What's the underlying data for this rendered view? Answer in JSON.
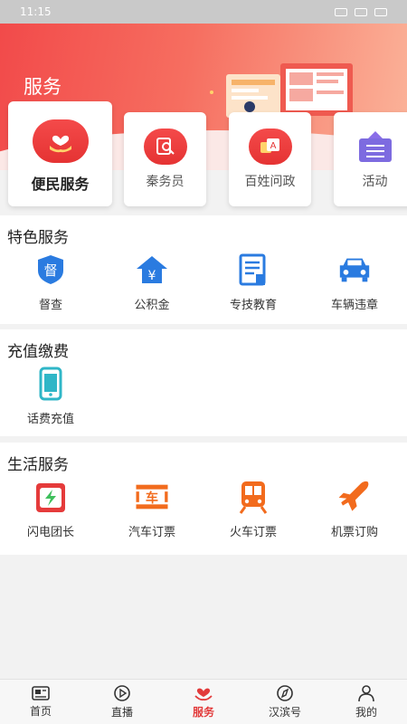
{
  "status_bar": {
    "time": "11:15",
    "battery": ""
  },
  "hero": {
    "title": "服务"
  },
  "top_cards": [
    {
      "label": "便民服务",
      "icon": "heart-hand-icon",
      "featured": true
    },
    {
      "label": "秦务员",
      "icon": "search-doc-icon"
    },
    {
      "label": "百姓问政",
      "icon": "question-chat-icon"
    },
    {
      "label": "活动",
      "icon": "event-board-icon"
    }
  ],
  "special_services": {
    "title": "特色服务",
    "items": [
      {
        "label": "督查",
        "icon": "supervise-shield-icon",
        "glyph": "督"
      },
      {
        "label": "公积金",
        "icon": "house-fund-icon",
        "glyph": "¥"
      },
      {
        "label": "专技教育",
        "icon": "education-doc-icon"
      },
      {
        "label": "车辆违章",
        "icon": "car-icon"
      }
    ]
  },
  "recharge": {
    "title": "充值缴费",
    "items": [
      {
        "label": "话费充值",
        "icon": "phone-icon"
      }
    ]
  },
  "life_services": {
    "title": "生活服务",
    "items": [
      {
        "label": "闪电团长",
        "icon": "lightning-bag-icon"
      },
      {
        "label": "汽车订票",
        "icon": "bus-ticket-icon",
        "glyph": "车"
      },
      {
        "label": "火车订票",
        "icon": "train-icon"
      },
      {
        "label": "机票订购",
        "icon": "airplane-icon"
      }
    ]
  },
  "tabbar": [
    {
      "label": "首页",
      "icon": "home-news-icon",
      "active": false
    },
    {
      "label": "直播",
      "icon": "live-play-icon",
      "active": false
    },
    {
      "label": "服务",
      "icon": "service-heart-icon",
      "active": true
    },
    {
      "label": "汉滨号",
      "icon": "compass-icon",
      "active": false
    },
    {
      "label": "我的",
      "icon": "person-icon",
      "active": false
    }
  ],
  "colors": {
    "brand_red": "#e23b3b",
    "accent_blue": "#2a7be0",
    "accent_orange": "#f26b1d",
    "teal": "#2fb6c7"
  }
}
